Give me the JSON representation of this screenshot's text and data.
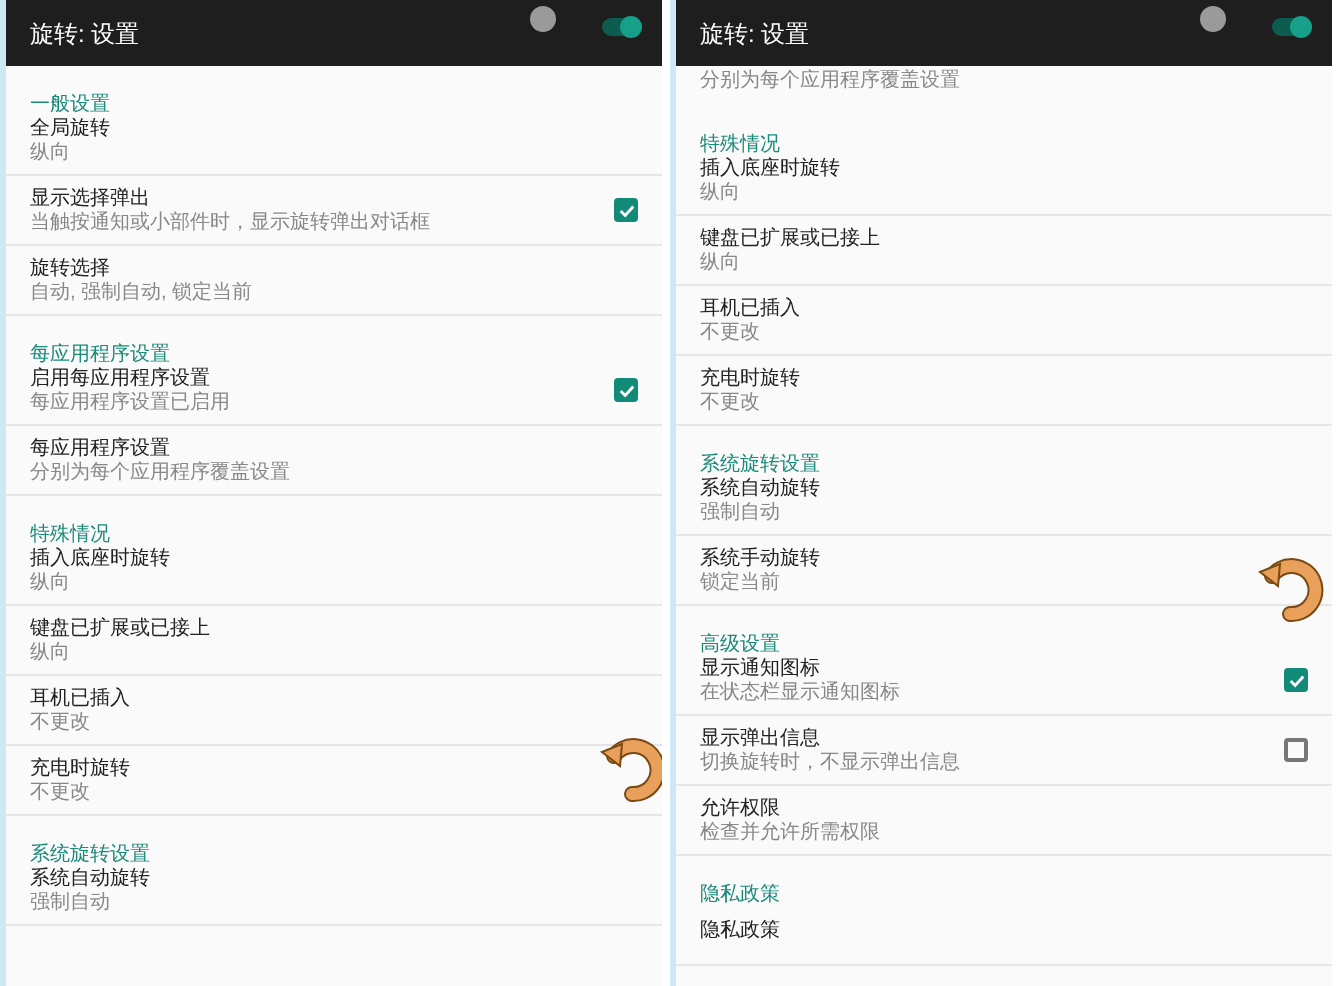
{
  "screens": [
    {
      "title": "旋转: 设置",
      "toggle": {
        "on": true
      },
      "items": [
        {
          "kind": "header",
          "title": "一般设置"
        },
        {
          "kind": "setting",
          "title": "全局旋转",
          "subtitle": "纵向"
        },
        {
          "kind": "setting",
          "title": "显示选择弹出",
          "subtitle": "当触按通知或小部件时，显示旋转弹出对话框",
          "checked": true
        },
        {
          "kind": "setting",
          "title": "旋转选择",
          "subtitle": "自动, 强制自动, 锁定当前"
        },
        {
          "kind": "header",
          "title": "每应用程序设置"
        },
        {
          "kind": "setting",
          "title": "启用每应用程序设置",
          "subtitle": "每应用程序设置已启用",
          "checked": true
        },
        {
          "kind": "setting",
          "title": "每应用程序设置",
          "subtitle": "分别为每个应用程序覆盖设置"
        },
        {
          "kind": "header",
          "title": "特殊情况"
        },
        {
          "kind": "setting",
          "title": "插入底座时旋转",
          "subtitle": "纵向"
        },
        {
          "kind": "setting",
          "title": "键盘已扩展或已接上",
          "subtitle": "纵向"
        },
        {
          "kind": "setting",
          "title": "耳机已插入",
          "subtitle": "不更改"
        },
        {
          "kind": "setting",
          "title": "充电时旋转",
          "subtitle": "不更改"
        },
        {
          "kind": "header",
          "title": "系统旋转设置"
        },
        {
          "kind": "setting",
          "title": "系统自动旋转",
          "subtitle": "强制自动"
        }
      ]
    },
    {
      "title": "旋转: 设置",
      "toggle": {
        "on": true
      },
      "items": [
        {
          "kind": "partial",
          "subtitle": "分别为每个应用程序覆盖设置"
        },
        {
          "kind": "header",
          "title": "特殊情况"
        },
        {
          "kind": "setting",
          "title": "插入底座时旋转",
          "subtitle": "纵向"
        },
        {
          "kind": "setting",
          "title": "键盘已扩展或已接上",
          "subtitle": "纵向"
        },
        {
          "kind": "setting",
          "title": "耳机已插入",
          "subtitle": "不更改"
        },
        {
          "kind": "setting",
          "title": "充电时旋转",
          "subtitle": "不更改"
        },
        {
          "kind": "header",
          "title": "系统旋转设置"
        },
        {
          "kind": "setting",
          "title": "系统自动旋转",
          "subtitle": "强制自动"
        },
        {
          "kind": "setting",
          "title": "系统手动旋转",
          "subtitle": "锁定当前"
        },
        {
          "kind": "header",
          "title": "高级设置"
        },
        {
          "kind": "setting",
          "title": "显示通知图标",
          "subtitle": "在状态栏显示通知图标",
          "checked": true
        },
        {
          "kind": "setting",
          "title": "显示弹出信息",
          "subtitle": "切换旋转时，不显示弹出信息",
          "checked": false
        },
        {
          "kind": "setting",
          "title": "允许权限",
          "subtitle": "检查并允许所需权限"
        },
        {
          "kind": "header",
          "title": "隐私政策"
        },
        {
          "kind": "setting",
          "title": "隐私政策"
        }
      ]
    }
  ]
}
